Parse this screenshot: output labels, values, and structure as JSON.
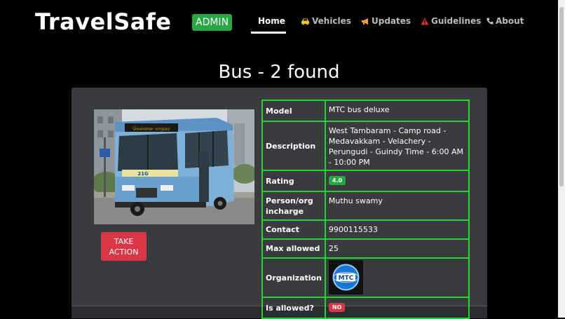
{
  "nav": {
    "brand": "TravelSafe",
    "admin_badge": "ADMIN",
    "items": [
      {
        "label": "Home",
        "icon": "home"
      },
      {
        "label": "Vehicles",
        "icon": "car-icon",
        "icon_color": "#f5c518"
      },
      {
        "label": "Updates",
        "icon": "megaphone-icon",
        "icon_color": "#f0a030"
      },
      {
        "label": "Guidelines",
        "icon": "warning-icon",
        "icon_color": "#e03030"
      },
      {
        "label": "About",
        "icon": "phone-icon",
        "icon_color": "#ccc"
      }
    ]
  },
  "page": {
    "title": "Bus - 2 found"
  },
  "card": {
    "action_button": "TAKE ACTION",
    "details": [
      {
        "label": "Model",
        "value": "MTC bus deluxe"
      },
      {
        "label": "Description",
        "value": "West Tambaram - Camp road - Medavakkam - Velachery - Perungudi - Guindy Time - 6:00 AM - 10:00 PM"
      },
      {
        "label": "Rating",
        "value": "4.0"
      },
      {
        "label": "Person/org incharge",
        "value": "Muthu swamy"
      },
      {
        "label": "Contact",
        "value": "9900115533"
      },
      {
        "label": "Max allowed",
        "value": "25"
      },
      {
        "label": "Organization",
        "logo_text": "MTC"
      },
      {
        "label": "Is allowed?",
        "value": "NO"
      }
    ]
  },
  "bus_sign": {
    "route": "21G",
    "front_text": "சென்னை மாநகர"
  },
  "colors": {
    "accent_green": "#29d32f",
    "badge_green": "#28a745",
    "danger_red": "#dc3545",
    "card_bg": "#3a3b3e"
  }
}
